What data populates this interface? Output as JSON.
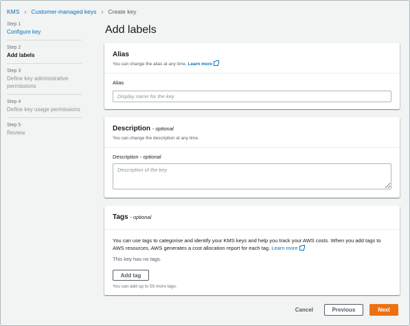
{
  "breadcrumb": {
    "items": [
      "KMS",
      "Customer-managed keys",
      "Create key"
    ]
  },
  "steps": [
    {
      "number": "Step 1",
      "title": "Configure key",
      "state": "link"
    },
    {
      "number": "Step 2",
      "title": "Add labels",
      "state": "active"
    },
    {
      "number": "Step 3",
      "title": "Define key administrative permissions",
      "state": "disabled"
    },
    {
      "number": "Step 4",
      "title": "Define key usage permissions",
      "state": "disabled"
    },
    {
      "number": "Step 5",
      "title": "Review",
      "state": "disabled"
    }
  ],
  "page_title": "Add labels",
  "alias_panel": {
    "title": "Alias",
    "description": "You can change the alias at any time.",
    "learn_more": "Learn more",
    "field_label": "Alias",
    "placeholder": "Display name for the key"
  },
  "description_panel": {
    "title": "Description",
    "title_suffix": "- optional",
    "description": "You can change the description at any time.",
    "field_label": "Description",
    "field_label_suffix": "- optional",
    "placeholder": "Description of the key"
  },
  "tags_panel": {
    "title": "Tags",
    "title_suffix": "- optional",
    "body": "You can use tags to categorise and identify your KMS keys and help you track your AWS costs. When you add tags to AWS resources, AWS generates a cost allocation report for each tag.",
    "learn_more": "Learn more",
    "empty_text": "This key has no tags.",
    "add_tag_label": "Add tag",
    "hint": "You can add up to 50 more tags."
  },
  "footer": {
    "cancel_label": "Cancel",
    "previous_label": "Previous",
    "next_label": "Next"
  },
  "colors": {
    "link": "#0073bb",
    "primary": "#ec7211",
    "background": "#f2f3f3"
  }
}
